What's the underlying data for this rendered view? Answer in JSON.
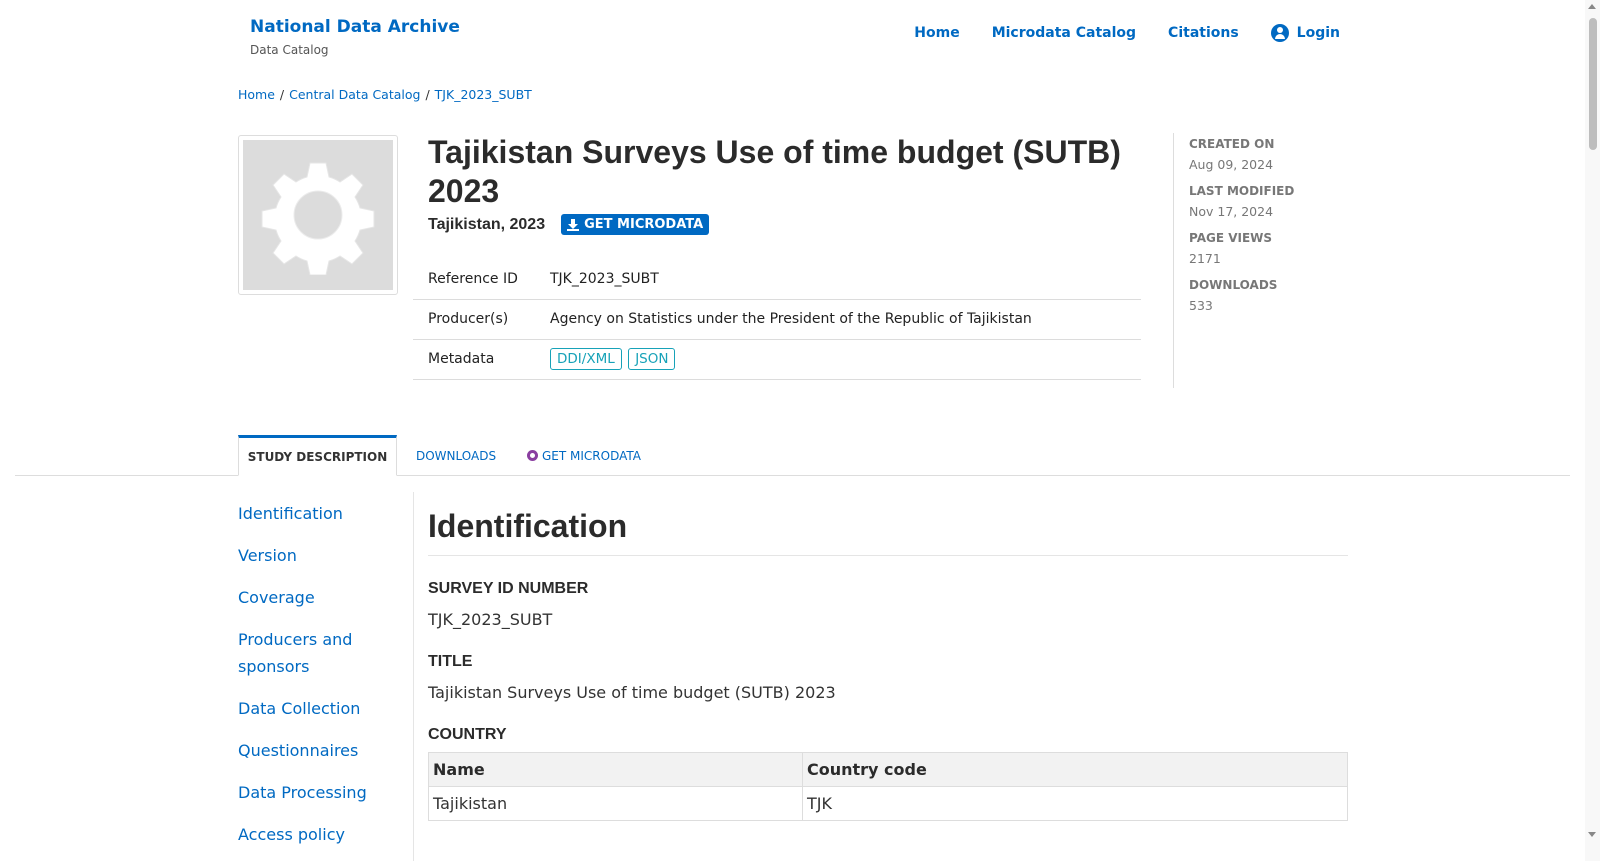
{
  "header": {
    "brand_title": "National Data Archive",
    "brand_sub": "Data Catalog",
    "nav": [
      "Home",
      "Microdata Catalog",
      "Citations",
      "Login"
    ]
  },
  "breadcrumb": [
    "Home",
    "Central Data Catalog",
    "TJK_2023_SUBT"
  ],
  "study": {
    "title": "Tajikistan Surveys Use of time budget (SUTB) 2023",
    "country_year": "Tajikistan, 2023",
    "get_microdata": "GET MICRODATA",
    "meta": {
      "ref_label": "Reference ID",
      "ref_value": "TJK_2023_SUBT",
      "producer_label": "Producer(s)",
      "producer_value": "Agency on Statistics under the President of the Republic of Tajikistan",
      "metadata_label": "Metadata",
      "ddi": "DDI/XML",
      "json": "JSON"
    }
  },
  "stats": {
    "created_label": "CREATED ON",
    "created_value": "Aug 09, 2024",
    "modified_label": "LAST MODIFIED",
    "modified_value": "Nov 17, 2024",
    "views_label": "PAGE VIEWS",
    "views_value": "2171",
    "downloads_label": "DOWNLOADS",
    "downloads_value": "533"
  },
  "tabs": {
    "study_description": "STUDY DESCRIPTION",
    "downloads": "DOWNLOADS",
    "get_microdata": "GET MICRODATA"
  },
  "leftnav": [
    "Identification",
    "Version",
    "Coverage",
    "Producers and sponsors",
    "Data Collection",
    "Questionnaires",
    "Data Processing",
    "Access policy"
  ],
  "identification": {
    "heading": "Identification",
    "survey_id_label": "SURVEY ID NUMBER",
    "survey_id_value": "TJK_2023_SUBT",
    "title_label": "TITLE",
    "title_value": "Tajikistan Surveys Use of time budget (SUTB) 2023",
    "country_label": "COUNTRY",
    "country_table": {
      "headers": [
        "Name",
        "Country code"
      ],
      "rows": [
        [
          "Tajikistan",
          "TJK"
        ]
      ]
    }
  }
}
